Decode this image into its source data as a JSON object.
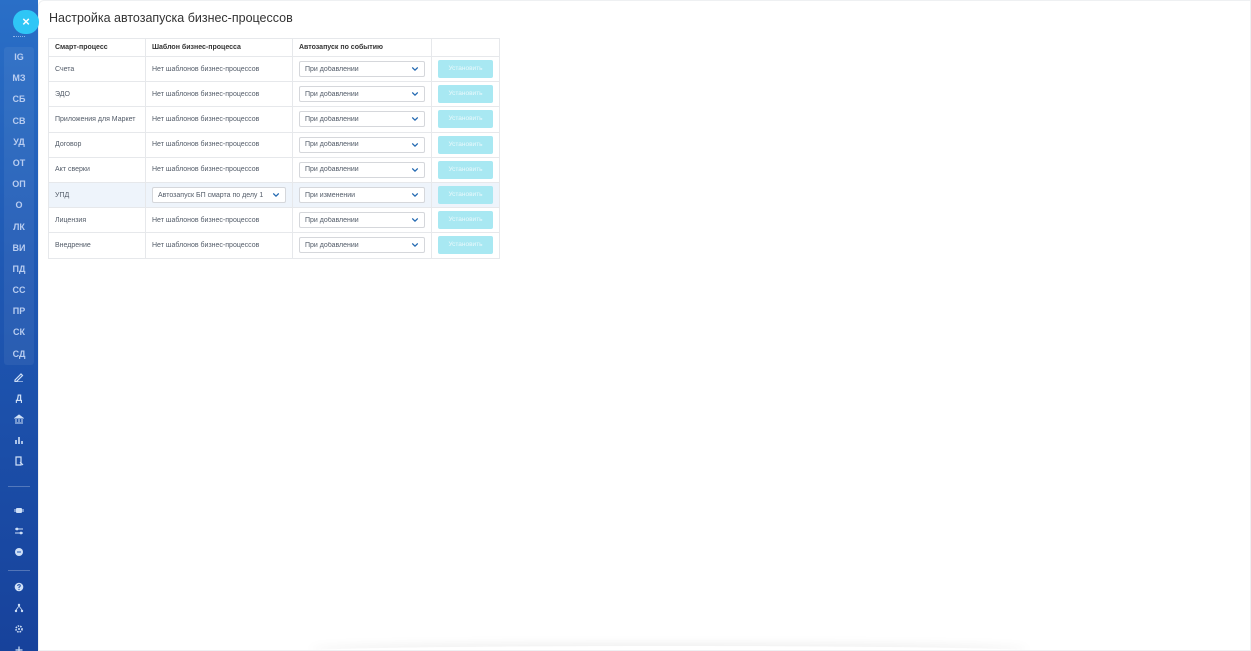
{
  "sidebar": {
    "close_label": "×",
    "codes": [
      "IG",
      "МЗ",
      "СБ",
      "СВ",
      "УД",
      "ОТ",
      "ОП",
      "О",
      "ЛК",
      "ВИ",
      "ПД",
      "СС",
      "ПР",
      "СК",
      "СД"
    ],
    "tool_icons": [
      "pen-icon",
      "docs-icon",
      "bank-icon",
      "chart-icon",
      "report-icon"
    ],
    "tool_labels": [
      "",
      "Д",
      "",
      "",
      ""
    ],
    "bottom_icons_a": [
      "robot-icon",
      "sliders-icon",
      "circle-minus-icon"
    ],
    "bottom_icons_b": [
      "help-icon",
      "sitemap-icon",
      "settings-icon",
      "plus-icon"
    ]
  },
  "page": {
    "title": "Настройка автозапуска бизнес-процессов"
  },
  "table": {
    "headers": [
      "Смарт-процесс",
      "Шаблон бизнес-процесса",
      "Автозапуск по событию",
      ""
    ],
    "button_label": "Установить",
    "rows": [
      {
        "process": "Счета",
        "template": "Нет шаблонов бизнес-процессов",
        "event": "При добавлении",
        "template_select": false
      },
      {
        "process": "ЭДО",
        "template": "Нет шаблонов бизнес-процессов",
        "event": "При добавлении",
        "template_select": false
      },
      {
        "process": "Приложения для Маркет",
        "template": "Нет шаблонов бизнес-процессов",
        "event": "При добавлении",
        "template_select": false
      },
      {
        "process": "Договор",
        "template": "Нет шаблонов бизнес-процессов",
        "event": "При добавлении",
        "template_select": false
      },
      {
        "process": "Акт сверки",
        "template": "Нет шаблонов бизнес-процессов",
        "event": "При добавлении",
        "template_select": false
      },
      {
        "process": "УПД",
        "template": "Автозапуск БП смарта по делу 1",
        "event": "При изменении",
        "template_select": true
      },
      {
        "process": "Лицензия",
        "template": "Нет шаблонов бизнес-процессов",
        "event": "При добавлении",
        "template_select": false
      },
      {
        "process": "Внедрение",
        "template": "Нет шаблонов бизнес-процессов",
        "event": "При добавлении",
        "template_select": false
      }
    ]
  },
  "colors": {
    "accent": "#2fc6f6",
    "button_disabled": "#a8e8f2",
    "sidebar": "#1f59b4",
    "highlight_row": "#eef4fb"
  }
}
